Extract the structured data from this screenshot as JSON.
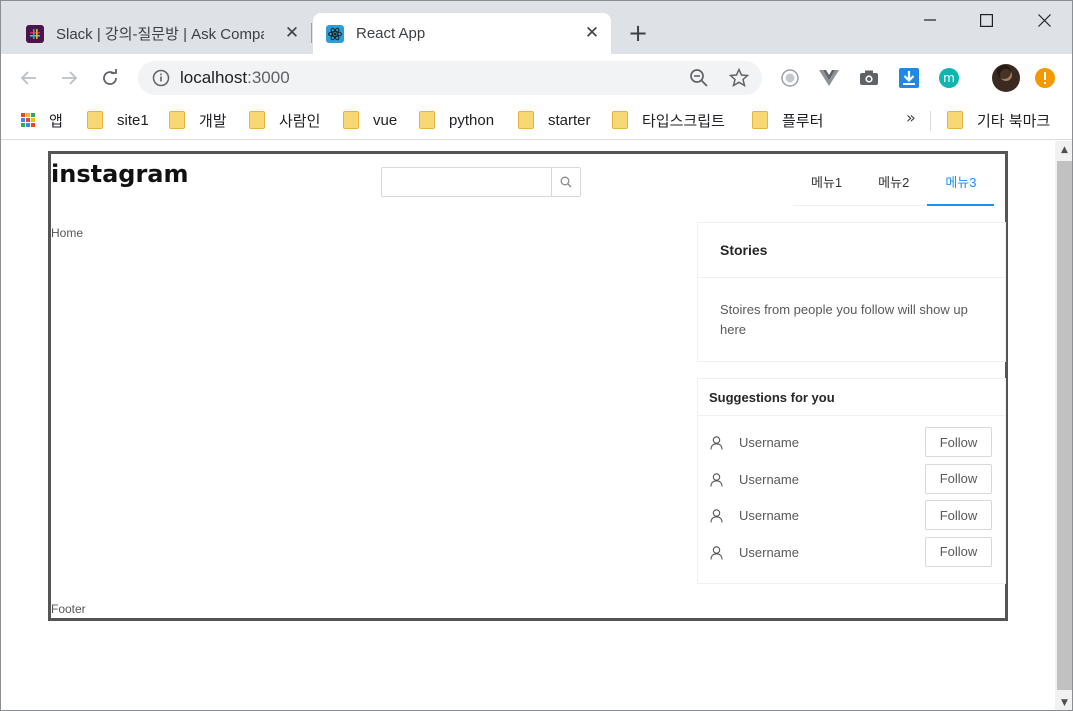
{
  "browser": {
    "tabs": [
      {
        "title": "Slack | 강의-질문방 | Ask Company",
        "favicon": "slack-icon"
      },
      {
        "title": "React App",
        "favicon": "react-icon",
        "active": true
      }
    ],
    "close_glyph": "✕",
    "new_tab_glyph": "+",
    "url_host": "localhost",
    "url_port": ":3000",
    "bookmarks": [
      {
        "label": "앱",
        "icon": "apps-icon"
      },
      {
        "label": "site1",
        "icon": "folder-icon"
      },
      {
        "label": "개발",
        "icon": "folder-icon"
      },
      {
        "label": "사람인",
        "icon": "folder-icon"
      },
      {
        "label": "vue",
        "icon": "folder-icon"
      },
      {
        "label": "python",
        "icon": "folder-icon"
      },
      {
        "label": "starter",
        "icon": "folder-icon"
      },
      {
        "label": "타입스크립트",
        "icon": "folder-icon"
      },
      {
        "label": "플루터",
        "icon": "folder-icon"
      }
    ],
    "more_glyph": "»",
    "other_bookmarks": "기타 북마크",
    "colors": {
      "tabstrip": "#dee1e6",
      "accent": "#1890ff",
      "folder": "#f8d775"
    }
  },
  "app": {
    "logo": "instagram",
    "search_placeholder": "",
    "menu": [
      {
        "label": "메뉴1"
      },
      {
        "label": "메뉴2"
      },
      {
        "label": "메뉴3",
        "active": true
      }
    ],
    "home_label": "Home",
    "footer_label": "Footer",
    "stories": {
      "title": "Stories",
      "body": "Stoires from people you follow will show up here"
    },
    "suggestions": {
      "title": "Suggestions for you",
      "items": [
        {
          "username": "Username",
          "button": "Follow"
        },
        {
          "username": "Username",
          "button": "Follow"
        },
        {
          "username": "Username",
          "button": "Follow"
        },
        {
          "username": "Username",
          "button": "Follow"
        }
      ]
    }
  }
}
